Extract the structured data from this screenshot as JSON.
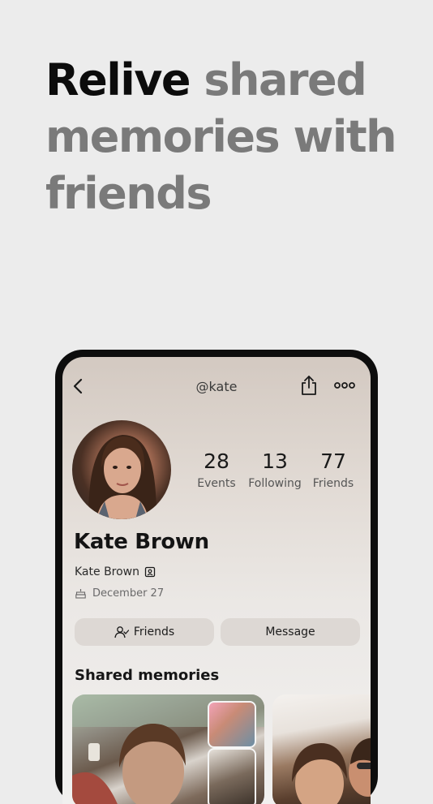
{
  "headline": {
    "strong": "Relive",
    "rest": " shared memories with friends"
  },
  "profile": {
    "handle": "@kate",
    "name": "Kate Brown",
    "sub_name": "Kate Brown",
    "birthday": "December 27",
    "stats": [
      {
        "value": "28",
        "label": "Events"
      },
      {
        "value": "13",
        "label": "Following"
      },
      {
        "value": "77",
        "label": "Friends"
      }
    ],
    "buttons": {
      "friends": "Friends",
      "message": "Message"
    },
    "section_title": "Shared memories"
  },
  "icons": {
    "back": "chevron-left-icon",
    "share": "share-icon",
    "more": "more-horizontal-icon",
    "contact": "contact-card-icon",
    "cake": "cake-icon",
    "friends": "user-check-icon"
  }
}
